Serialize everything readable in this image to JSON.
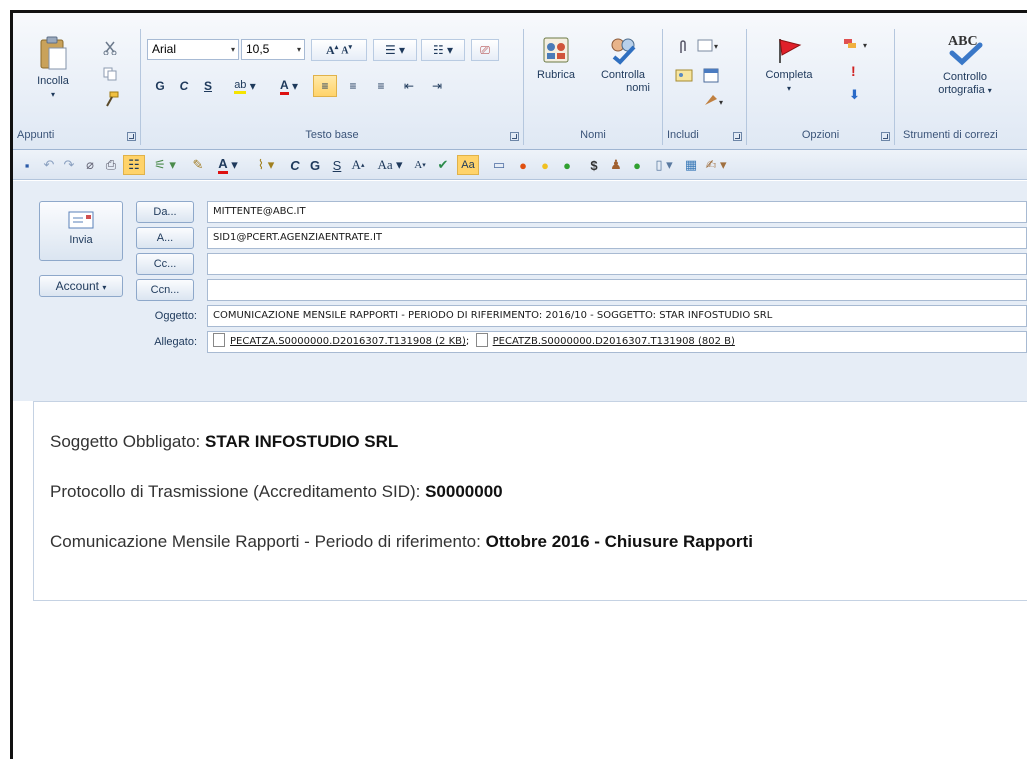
{
  "ribbon": {
    "clipboard": {
      "paste_label": "Incolla",
      "group_label": "Appunti"
    },
    "basic_text": {
      "font": "Arial",
      "size": "10,5",
      "bold": "G",
      "italic": "C",
      "underline": "S",
      "group_label": "Testo base"
    },
    "names": {
      "address_book": "Rubrica",
      "check_names_1": "Controlla",
      "check_names_2": "nomi",
      "group_label": "Nomi"
    },
    "include": {
      "group_label": "Includi"
    },
    "options": {
      "followup_label": "Completa",
      "group_label": "Opzioni"
    },
    "proofing": {
      "spelling_1": "Controllo",
      "spelling_2": "ortografia",
      "group_label": "Strumenti di correzi",
      "abc": "ABC"
    }
  },
  "qat": {
    "italic": "C",
    "bold": "G",
    "underline": "S"
  },
  "header": {
    "send_label": "Invia",
    "account_label": "Account",
    "from_button": "Da...",
    "to_button": "A...",
    "cc_button": "Cc...",
    "bcc_button": "Ccn...",
    "from_value": "MITTENTE@ABC.IT",
    "to_value": "SID1@PCERT.AGENZIAENTRATE.IT",
    "cc_value": "",
    "bcc_value": "",
    "subject_label": "Oggetto:",
    "subject_value": "COMUNICAZIONE MENSILE RAPPORTI - PERIODO DI RIFERIMENTO:  2016/10 - SOGGETTO: STAR INFOSTUDIO SRL",
    "attachment_label": "Allegato:",
    "attachments": [
      {
        "name": "PECATZA.S0000000.D2016307.T131908 (2 KB)"
      },
      {
        "name": "PECATZB.S0000000.D2016307.T131908 (802 B)"
      }
    ]
  },
  "body": {
    "line1_label": "Soggetto Obbligato: ",
    "line1_value": "STAR INFOSTUDIO SRL",
    "line2_label": "Protocollo di Trasmissione (Accreditamento SID): ",
    "line2_value": "S0000000",
    "line3_label": "Comunicazione Mensile Rapporti - Periodo di riferimento: ",
    "line3_value": "Ottobre 2016 - Chiusure Rapporti"
  },
  "colors": {
    "ribbon_bg": "#dfe8f4",
    "header_bg": "#e6edf6",
    "text": "#1e395b",
    "highlight": "#ffd36a"
  }
}
